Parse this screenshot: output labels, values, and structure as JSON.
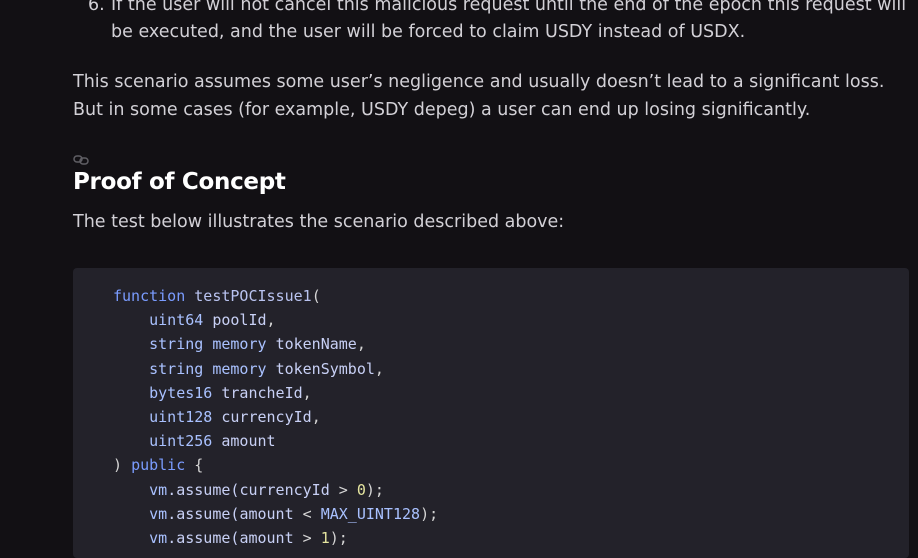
{
  "list": {
    "number": "6.",
    "text": "If the user will not cancel this malicious request until the end of the epoch this request will be executed, and the user will be forced to claim USDY instead of USDX."
  },
  "paragraph": "This scenario assumes some user’s negligence and usually doesn’t lead to a significant loss. But in some cases (for example, USDY depeg) a user can end up losing significantly.",
  "section": {
    "anchor_icon": "link-icon",
    "title": "Proof of Concept",
    "intro": "The test below illustrates the scenario described above:"
  },
  "code": {
    "line1": {
      "kw": "function",
      "fn": "testPOCIssue1",
      "punc": "("
    },
    "line2": {
      "ty": "uint64",
      "id": "poolId",
      "punc": ","
    },
    "line3": {
      "ty": "string memory",
      "id": "tokenName",
      "punc": ","
    },
    "line4": {
      "ty": "string memory",
      "id": "tokenSymbol",
      "punc": ","
    },
    "line5": {
      "ty": "bytes16",
      "id": "trancheId",
      "punc": ","
    },
    "line6": {
      "ty": "uint128",
      "id": "currencyId",
      "punc": ","
    },
    "line7": {
      "ty": "uint256",
      "id": "amount"
    },
    "line8": {
      "punc_open": ")",
      "kw": "public",
      "punc": "{"
    },
    "line9": {
      "obj": "vm",
      "method": ".assume(",
      "arg": "currencyId",
      "op": " > ",
      "num": "0",
      "end": ");"
    },
    "line10": {
      "obj": "vm",
      "method": ".assume(",
      "arg": "amount",
      "op": " < ",
      "const": "MAX_UINT128",
      "end": ");"
    },
    "line11": {
      "obj": "vm",
      "method": ".assume(",
      "arg": "amount",
      "op": " > ",
      "num": "1",
      "end": ");"
    }
  },
  "colors": {
    "background": "#121014",
    "code_background": "#23222a",
    "heading": "#ffffff",
    "body_text": "#d2d0d6"
  }
}
